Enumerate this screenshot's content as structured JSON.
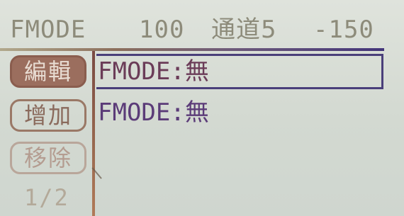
{
  "header": {
    "title": "FMODE",
    "value": "100",
    "channel": "通道5",
    "amount": "-150"
  },
  "menu": {
    "items": [
      {
        "label": "編輯",
        "active": true
      },
      {
        "label": "增加",
        "active": false
      },
      {
        "label": "移除",
        "active": false
      }
    ],
    "page": "1/2"
  },
  "list": {
    "rows": [
      {
        "text": "FMODE:無",
        "selected": true
      },
      {
        "text": "FMODE:無",
        "selected": false
      }
    ]
  },
  "colors": {
    "background": "#d6dbd4",
    "header_text": "#8d8b7a",
    "active_button": "#9b6e5e",
    "list_text": "#5e3f7a"
  }
}
